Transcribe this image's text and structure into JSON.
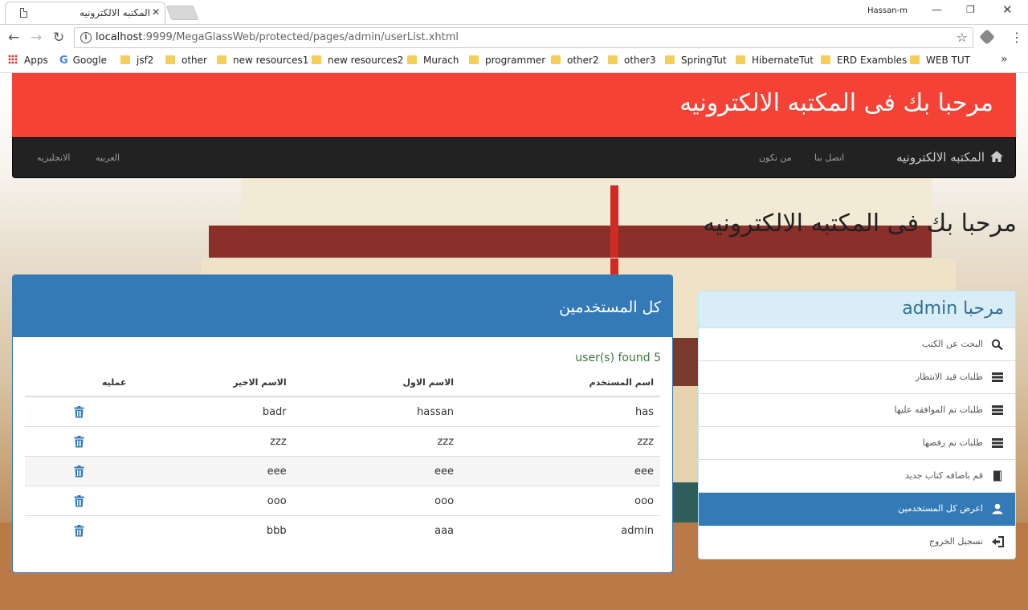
{
  "browser": {
    "tab_title": "المكتبه الالكترونيه",
    "tab_close": "✕",
    "profile_name": "Hassan-m",
    "url_host": "localhost",
    "url_rest": ":9999/MegaGlassWeb/protected/pages/admin/userList.xhtml",
    "bookmarks": [
      "Apps",
      "Google",
      "jsf2",
      "other",
      "new resources1",
      "new resources2",
      "Murach",
      "programmer",
      "other2",
      "other3",
      "SpringTut",
      "HibernateTut",
      "ERD Exambles",
      "WEB TUT"
    ],
    "bookmarks_more": "»"
  },
  "header": {
    "title": "مرحبا بك فى المكتبه الالكترونيه"
  },
  "navbar": {
    "brand": "المكتبه الالكترونيه",
    "links": [
      "اتصل بنا",
      "من نكون"
    ],
    "languages": [
      "العربيه",
      "الانجليزيه"
    ]
  },
  "hero": {
    "title": "مرحبا بك فى المكتبه الالكترونيه"
  },
  "sidebar": {
    "greeting": "مرحبا admin",
    "items": [
      {
        "label": "البحث عن الكتب",
        "icon": "search-icon"
      },
      {
        "label": "طلبات قيد الانتظار",
        "icon": "list-icon"
      },
      {
        "label": "طلبات تم الموافقه عليها",
        "icon": "list-icon"
      },
      {
        "label": "طلبات تم رفضها",
        "icon": "list-icon"
      },
      {
        "label": "قم باضافه كتاب جديد",
        "icon": "book-icon"
      },
      {
        "label": "اعرض كل المستخدمين",
        "icon": "user-icon",
        "active": true
      },
      {
        "label": "تسجيل الخروج",
        "icon": "logout-icon"
      }
    ]
  },
  "users_panel": {
    "title": "كل المستخدمين",
    "found_text": "user(s) found 5",
    "columns": [
      "اسم المستخدم",
      "الاسم الاول",
      "الاسم الاخير",
      "عمليه"
    ],
    "rows": [
      {
        "username": "has",
        "first": "hassan",
        "last": "badr"
      },
      {
        "username": "zzz",
        "first": "zzz",
        "last": "zzz"
      },
      {
        "username": "eee",
        "first": "eee",
        "last": "eee"
      },
      {
        "username": "ooo",
        "first": "ooo",
        "last": "ooo"
      },
      {
        "username": "admin",
        "first": "aaa",
        "last": "bbb"
      }
    ]
  },
  "colors": {
    "header_red": "#f44336",
    "navbar": "#222222",
    "primary": "#337ab7",
    "info_bg": "#d9edf7",
    "success_text": "#3c763d"
  }
}
